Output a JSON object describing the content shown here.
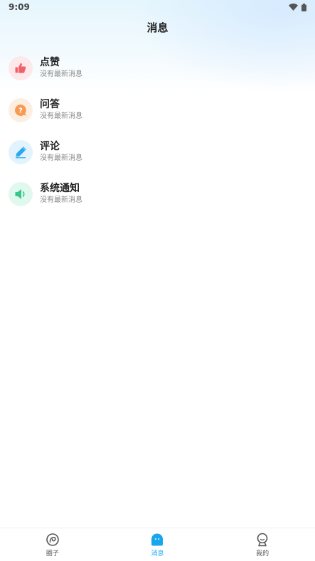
{
  "status_bar": {
    "time": "9:09"
  },
  "header": {
    "title": "消息"
  },
  "messages": [
    {
      "title": "点赞",
      "subtitle": "没有最新消息",
      "icon": "thumbs-up-icon",
      "icon_color": "#f2606a",
      "icon_bg": "#fde9ea"
    },
    {
      "title": "问答",
      "subtitle": "没有最新消息",
      "icon": "question-icon",
      "icon_color": "#f79a52",
      "icon_bg": "#fdeee2"
    },
    {
      "title": "评论",
      "subtitle": "没有最新消息",
      "icon": "pencil-icon",
      "icon_color": "#29a8f2",
      "icon_bg": "#e2f3fd"
    },
    {
      "title": "系统通知",
      "subtitle": "没有最新消息",
      "icon": "speaker-icon",
      "icon_color": "#34c98a",
      "icon_bg": "#e1f8ee"
    }
  ],
  "tab_bar": {
    "active_color": "#19a6ec",
    "tabs": [
      {
        "label": "圈子",
        "icon": "circle-icon",
        "active": false
      },
      {
        "label": "消息",
        "icon": "chat-ghost-icon",
        "active": true
      },
      {
        "label": "我的",
        "icon": "profile-icon",
        "active": false
      }
    ]
  }
}
